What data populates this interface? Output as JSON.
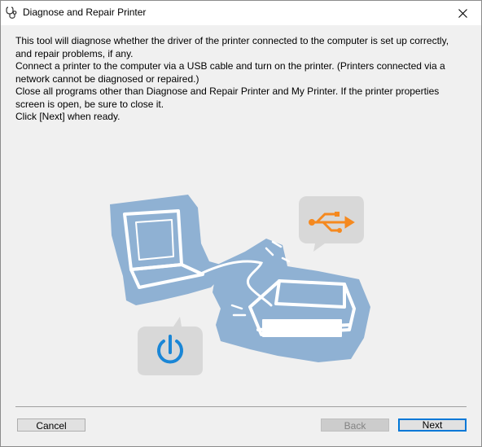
{
  "window": {
    "title": "Diagnose and Repair Printer"
  },
  "description": {
    "lines": [
      "This tool will diagnose whether the driver of the printer connected to the computer is set up correctly,",
      "and repair problems, if any.",
      "Connect a printer to the computer via a USB cable and turn on the printer. (Printers connected via a",
      "network cannot be diagnosed or repaired.)",
      "Close all programs other than Diagnose and Repair Printer and My Printer. If the printer properties",
      "screen is open, be sure to close it.",
      "Click [Next] when ready."
    ]
  },
  "illustration": {
    "icons": [
      "laptop-icon",
      "printer-icon",
      "usb-icon",
      "power-icon"
    ],
    "colors": {
      "blob": "#8fb1d3",
      "usb": "#f5891f",
      "power": "#1a86d6",
      "bubble": "#d8d8d8"
    }
  },
  "buttons": {
    "cancel": "Cancel",
    "back": "Back",
    "next": "Next"
  }
}
